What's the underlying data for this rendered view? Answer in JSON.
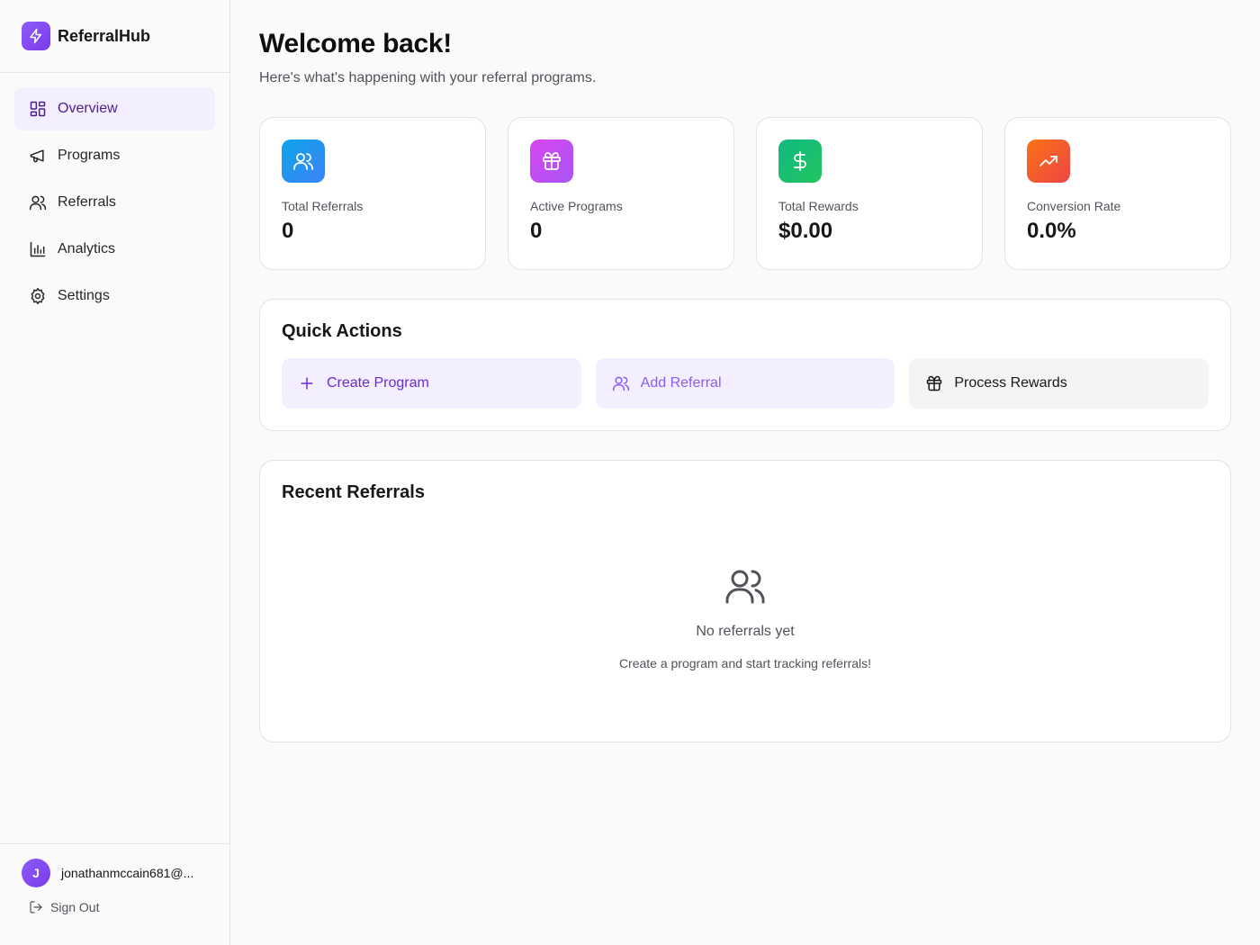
{
  "brand": {
    "name": "ReferralHub",
    "logo_icon": "lightning-icon",
    "accent": "#7c3aed"
  },
  "sidebar": {
    "items": [
      {
        "label": "Overview",
        "icon": "dashboard-icon",
        "active": true
      },
      {
        "label": "Programs",
        "icon": "megaphone-icon",
        "active": false
      },
      {
        "label": "Referrals",
        "icon": "users-icon",
        "active": false
      },
      {
        "label": "Analytics",
        "icon": "bar-chart-icon",
        "active": false
      },
      {
        "label": "Settings",
        "icon": "gear-icon",
        "active": false
      }
    ],
    "user": {
      "initial": "J",
      "email": "jonathanmccain681@..."
    },
    "sign_out_label": "Sign Out"
  },
  "header": {
    "title": "Welcome back!",
    "subtitle": "Here's what's happening with your referral programs."
  },
  "stats": [
    {
      "label": "Total Referrals",
      "value": "0",
      "icon": "users-icon",
      "color": "#0ea5e9"
    },
    {
      "label": "Active Programs",
      "value": "0",
      "icon": "gift-icon",
      "color": "#d946ef"
    },
    {
      "label": "Total Rewards",
      "value": "$0.00",
      "icon": "dollar-icon",
      "color": "#10b981"
    },
    {
      "label": "Conversion Rate",
      "value": "0.0%",
      "icon": "trending-up-icon",
      "color": "#f97316"
    }
  ],
  "quick_actions": {
    "title": "Quick Actions",
    "items": [
      {
        "label": "Create Program",
        "icon": "plus-icon"
      },
      {
        "label": "Add Referral",
        "icon": "users-icon"
      },
      {
        "label": "Process Rewards",
        "icon": "gift-icon"
      }
    ]
  },
  "recent_referrals": {
    "title": "Recent Referrals",
    "empty_icon": "users-icon",
    "empty_title": "No referrals yet",
    "empty_subtitle": "Create a program and start tracking referrals!"
  }
}
